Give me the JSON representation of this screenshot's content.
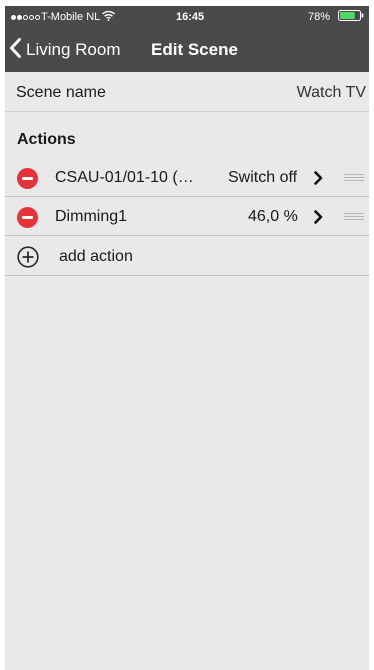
{
  "status_bar": {
    "carrier": "T-Mobile NL",
    "time": "16:45",
    "battery": "78%",
    "signal_strength": 2,
    "signal_total": 5,
    "battery_level": 0.78
  },
  "nav": {
    "back_label": "Living Room",
    "title": "Edit Scene"
  },
  "scene": {
    "label": "Scene name",
    "value": "Watch TV"
  },
  "actions": {
    "header": "Actions",
    "items": [
      {
        "name": "CSAU-01/01-10  (…",
        "value": "Switch off"
      },
      {
        "name": "Dimming1",
        "value": "46,0 %"
      }
    ],
    "add_label": "add action"
  },
  "icons": {
    "back": "chevron-left-icon",
    "remove": "minus-circle-icon",
    "disclosure": "chevron-right-icon",
    "reorder": "drag-handle-icon",
    "add": "plus-circle-icon",
    "wifi": "wifi-icon",
    "battery": "battery-icon"
  },
  "colors": {
    "nav_background": "#4a4a4a",
    "page_background": "#e9e9e9",
    "delete_red": "#e8323a",
    "battery_green": "#4cd964"
  }
}
